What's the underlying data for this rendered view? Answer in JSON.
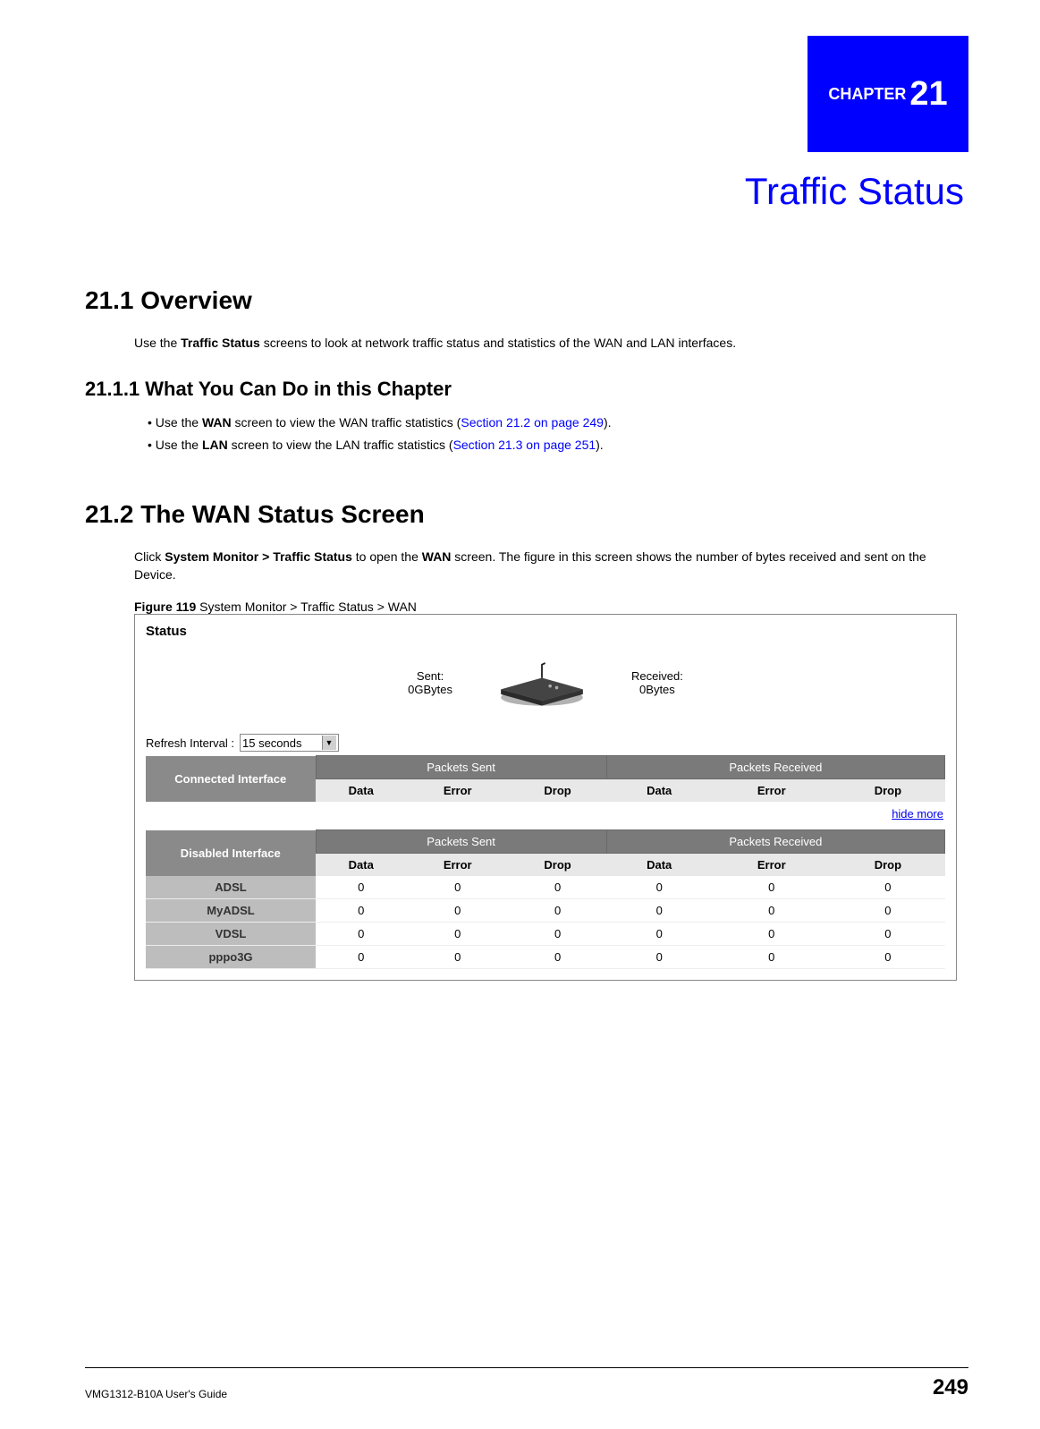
{
  "chapter": {
    "number_prefix": "CHAPTER   ",
    "number": "21",
    "title": "Traffic Status"
  },
  "sections": {
    "overview": {
      "heading": "21.1  Overview",
      "para_pre": "Use the ",
      "para_bold": "Traffic Status",
      "para_post": " screens to look at network traffic status and statistics of the WAN and LAN interfaces."
    },
    "what_you_can_do": {
      "heading": "21.1.1  What You Can Do in this Chapter",
      "bullets": [
        {
          "pre": "•  Use the ",
          "bold": "WAN",
          "mid": " screen to view the WAN traffic statistics (",
          "xref": "Section 21.2 on page 249",
          "post": ")."
        },
        {
          "pre": "•  Use the ",
          "bold": "LAN",
          "mid": " screen to view the LAN traffic statistics (",
          "xref": "Section 21.3 on page 251",
          "post": ")."
        }
      ]
    },
    "wan_status": {
      "heading": "21.2  The WAN Status Screen",
      "para_pre": "Click ",
      "para_bold": "System Monitor > Traffic Status",
      "para_mid": " to open the ",
      "para_bold2": "WAN",
      "para_post": " screen. The figure in this screen shows the number of bytes received and sent on the Device."
    }
  },
  "figure": {
    "label": "Figure 119",
    "caption": "   System Monitor > Traffic Status > WAN"
  },
  "screenshot": {
    "title": "Status",
    "summary": {
      "sent_label": "Sent:",
      "sent_value": "0GBytes",
      "received_label": "Received:",
      "received_value": "0Bytes"
    },
    "refresh": {
      "label": "Refresh Interval :",
      "value": "15 seconds"
    },
    "connected": {
      "header_interface": "Connected Interface",
      "header_sent": "Packets Sent",
      "header_received": "Packets Received",
      "sub_headers": [
        "Data",
        "Error",
        "Drop",
        "Data",
        "Error",
        "Drop"
      ]
    },
    "hide_more": "hide more",
    "disabled": {
      "header_interface": "Disabled Interface",
      "header_sent": "Packets Sent",
      "header_received": "Packets Received",
      "sub_headers": [
        "Data",
        "Error",
        "Drop",
        "Data",
        "Error",
        "Drop"
      ],
      "rows": [
        {
          "name": "ADSL",
          "vals": [
            "0",
            "0",
            "0",
            "0",
            "0",
            "0"
          ]
        },
        {
          "name": "MyADSL",
          "vals": [
            "0",
            "0",
            "0",
            "0",
            "0",
            "0"
          ]
        },
        {
          "name": "VDSL",
          "vals": [
            "0",
            "0",
            "0",
            "0",
            "0",
            "0"
          ]
        },
        {
          "name": "pppo3G",
          "vals": [
            "0",
            "0",
            "0",
            "0",
            "0",
            "0"
          ]
        }
      ]
    }
  },
  "footer": {
    "guide": "VMG1312-B10A User's Guide",
    "page": "249"
  }
}
